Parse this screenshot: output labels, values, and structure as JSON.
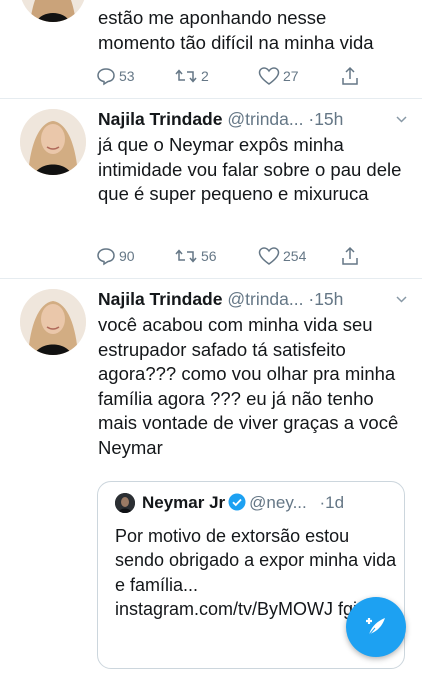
{
  "tweet_top": {
    "text_line1": "estão me aponhando nesse",
    "text_line2": "momento tão difícil na minha vida",
    "replies": "53",
    "retweets": "2",
    "likes": "27"
  },
  "tweet_1": {
    "name": "Najila Trindade",
    "handle": "@trinda...",
    "time": "·15h",
    "text": "já que o Neymar expôs minha intimidade vou falar sobre o pau dele que é super pequeno e mixuruca",
    "replies": "90",
    "retweets": "56",
    "likes": "254"
  },
  "tweet_2": {
    "name": "Najila Trindade",
    "handle": "@trinda...",
    "time": "·15h",
    "text": "você acabou com minha vida seu estrupador safado tá satisfeito agora??? como vou olhar pra minha família agora ??? eu já não tenho mais vontade de viver graças a você Neymar",
    "quote": {
      "name": "Neymar Jr",
      "handle": "@ney...",
      "time": "·1d",
      "text": "Por motivo de extorsão estou sendo obrigado a expor minha vida e família... instagram.com/tv/ByMOWJ fgicq..."
    }
  },
  "colors": {
    "accent": "#1da1f2",
    "secondary_text": "#657786",
    "divider": "#e6ecf0",
    "verified": "#1da1f2"
  },
  "icons": [
    "reply-icon",
    "retweet-icon",
    "like-icon",
    "share-icon",
    "caret-down-icon",
    "verified-icon",
    "compose-tweet-icon"
  ]
}
